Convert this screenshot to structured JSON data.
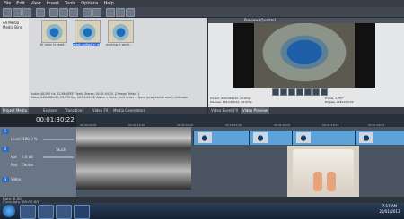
{
  "menu": {
    "file": "File",
    "edit": "Edit",
    "view": "View",
    "insert": "Insert",
    "tools": "Tools",
    "options": "Options",
    "help": "Help"
  },
  "media_tree": {
    "root": "All Media",
    "media_bins": "Media Bins"
  },
  "media_thumbs": [
    {
      "caption": "All color in read..."
    },
    {
      "caption": "mask softed in re..."
    },
    {
      "caption": "making it work..."
    }
  ],
  "media_info": {
    "line1": "Audio: 48,000 Hz, 32 Bit (IEEE Float), Stereo, 00:01:04:24, [Omega] Music 1",
    "line2": "Video: 640x360x32, 29.970 fps, 00:01:04:24, Alpha = None, Field Order = None (progressive scan), Unknown"
  },
  "media_tabs": {
    "project_media": "Project Media",
    "explorer": "Explorer",
    "transitions": "Transitions",
    "video_fx": "Video FX",
    "media_generators": "Media Generators"
  },
  "preview": {
    "title": "Preview (Quarter)",
    "project_label": "Project:",
    "project_value": "640x360x32, 29.970p",
    "preview_label": "Preview:",
    "preview_value": "320x180x32, 29.970p",
    "display_label": "Display:",
    "display_value": "226x127x32",
    "frame_label": "Frame:",
    "frame_value": "1,757"
  },
  "preview_tabs": {
    "video_event_fx": "Video Event FX",
    "video_preview": "Video Preview"
  },
  "timeline": {
    "timecode": "00:01:30;22",
    "ruler": [
      "00:00:00;00",
      "00:00:15;00",
      "00:00:30;00",
      "00:00:45;00",
      "00:01:00;02",
      "00:01:15;03",
      "00:01:30;03"
    ]
  },
  "tracks": [
    {
      "number": "1",
      "level_label": "Level: 100.0 %"
    },
    {
      "number": "2",
      "vol_label": "Vol:",
      "vol_value": "0.0 dB",
      "pan_label": "Pan:",
      "pan_value": "Center",
      "touch": "Touch"
    },
    {
      "number": "3",
      "label": "Video"
    }
  ],
  "status": {
    "rate": "Rate: 0.00",
    "complete": "Complete: 00:00:00"
  },
  "clock": {
    "time": "7:17 AM",
    "date": "25/01/2013"
  },
  "colors": {
    "accent": "#316ac5",
    "event": "#5ea3d8",
    "taskbar": "#1b2b40"
  }
}
